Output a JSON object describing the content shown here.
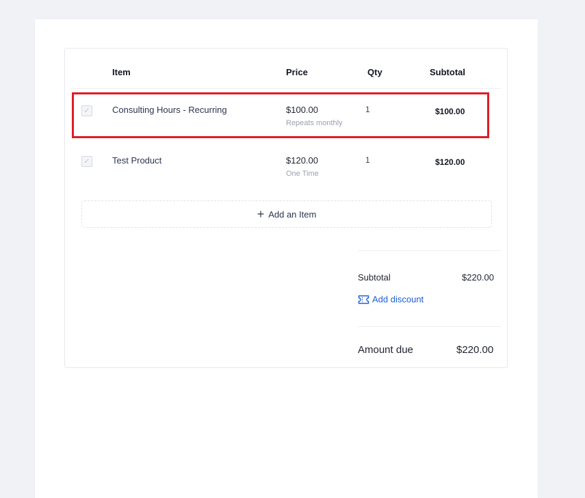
{
  "table": {
    "headers": {
      "item": "Item",
      "price": "Price",
      "qty": "Qty",
      "subtotal": "Subtotal"
    },
    "rows": [
      {
        "checked": true,
        "name": "Consulting Hours - Recurring",
        "price": "$100.00",
        "frequency": "Repeats monthly",
        "qty": "1",
        "subtotal": "$100.00"
      },
      {
        "checked": true,
        "name": "Test Product",
        "price": "$120.00",
        "frequency": "One Time",
        "qty": "1",
        "subtotal": "$120.00"
      }
    ]
  },
  "add_item": {
    "icon": "plus-icon",
    "label": "Add an Item"
  },
  "totals": {
    "subtotal_label": "Subtotal",
    "subtotal_value": "$220.00",
    "discount_icon": "ticket-icon",
    "add_discount_label": "Add discount",
    "amount_due_label": "Amount due",
    "amount_due_value": "$220.00"
  },
  "colors": {
    "highlight": "#e01b24",
    "link": "#1a5fd6",
    "background": "#f1f2f6"
  }
}
